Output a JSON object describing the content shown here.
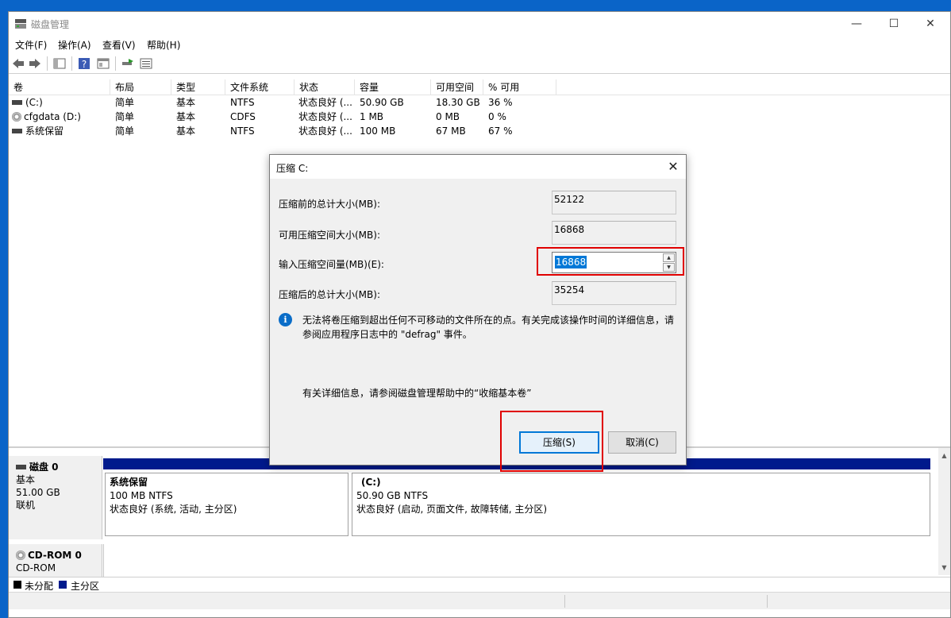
{
  "window": {
    "title": "磁盘管理",
    "controls": {
      "minimize": "—",
      "maximize": "☐",
      "close": "✕"
    }
  },
  "menu": [
    "文件(F)",
    "操作(A)",
    "查看(V)",
    "帮助(H)"
  ],
  "toolbar_icons": [
    "back-arrow-icon",
    "forward-arrow-icon",
    "console-tree-icon",
    "help-icon",
    "properties-icon",
    "refresh-icon",
    "list-view-icon"
  ],
  "columns": [
    "卷",
    "布局",
    "类型",
    "文件系统",
    "状态",
    "容量",
    "可用空间",
    "% 可用"
  ],
  "volumes": [
    {
      "name": "(C:)",
      "icon": "drive-icon",
      "layout": "简单",
      "type": "基本",
      "fs": "NTFS",
      "status": "状态良好 (...",
      "capacity": "50.90 GB",
      "free": "18.30 GB",
      "pct": "36 %"
    },
    {
      "name": "cfgdata (D:)",
      "icon": "cd-drive-icon",
      "layout": "简单",
      "type": "基本",
      "fs": "CDFS",
      "status": "状态良好 (...",
      "capacity": "1 MB",
      "free": "0 MB",
      "pct": "0 %"
    },
    {
      "name": "系统保留",
      "icon": "drive-icon",
      "layout": "简单",
      "type": "基本",
      "fs": "NTFS",
      "status": "状态良好 (...",
      "capacity": "100 MB",
      "free": "67 MB",
      "pct": "67 %"
    }
  ],
  "disks": [
    {
      "name": "磁盘 0",
      "type": "基本",
      "size": "51.00 GB",
      "state": "联机"
    },
    {
      "name": "CD-ROM 0",
      "type": "CD-ROM"
    }
  ],
  "partitions": [
    {
      "name": "系统保留",
      "size": "100 MB NTFS",
      "status": "状态良好 (系统, 活动, 主分区)"
    },
    {
      "name": "(C:)",
      "size": "50.90 GB NTFS",
      "status": "状态良好 (启动, 页面文件, 故障转储, 主分区)"
    }
  ],
  "legend": [
    {
      "label": "未分配",
      "color": "#000000"
    },
    {
      "label": "主分区",
      "color": "#001a8c"
    }
  ],
  "dialog": {
    "title": "压缩 C:",
    "total_before_label": "压缩前的总计大小(MB):",
    "total_before": "52122",
    "available_label": "可用压缩空间大小(MB):",
    "available": "16868",
    "input_label": "输入压缩空间量(MB)(E):",
    "input_value": "16868",
    "total_after_label": "压缩后的总计大小(MB):",
    "total_after": "35254",
    "info_text": "无法将卷压缩到超出任何不可移动的文件所在的点。有关完成该操作时间的详细信息，请参阅应用程序日志中的 \"defrag\" 事件。",
    "more_info": "有关详细信息，请参阅磁盘管理帮助中的“收缩基本卷”",
    "shrink_button": "压缩(S)",
    "cancel_button": "取消(C)"
  },
  "colors": {
    "highlight": "#e00000",
    "primary_partition": "#001a8c",
    "selection": "#0078d7"
  }
}
